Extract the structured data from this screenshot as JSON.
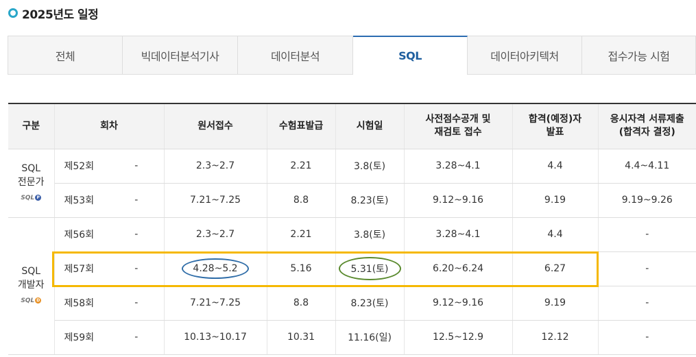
{
  "section_title": "2025년도 일정",
  "tabs": [
    {
      "label": "전체",
      "active": false
    },
    {
      "label": "빅데이터분석기사",
      "active": false
    },
    {
      "label": "데이터분석",
      "active": false
    },
    {
      "label": "SQL",
      "active": true
    },
    {
      "label": "데이터아키텍처",
      "active": false
    },
    {
      "label": "접수가능 시험",
      "active": false
    }
  ],
  "table": {
    "headers": [
      "구분",
      "회차",
      "원서접수",
      "수험표발급",
      "시험일",
      "사전점수공개 및\n재검토 접수",
      "합격(예정)자\n발표",
      "응시자격 서류제출\n(합격자 결정)"
    ],
    "groups": [
      {
        "name": "SQL\n전문가",
        "logo": "SQL",
        "logo_mark": "P",
        "logo_mark_color": "#3b5ea8",
        "rows": [
          {
            "round": "제52회",
            "sub": "-",
            "apply": "2.3~2.7",
            "ticket": "2.21",
            "exam": "3.8(토)",
            "review": "3.28~4.1",
            "announce": "4.4",
            "docs": "4.4~4.11"
          },
          {
            "round": "제53회",
            "sub": "-",
            "apply": "7.21~7.25",
            "ticket": "8.8",
            "exam": "8.23(토)",
            "review": "9.12~9.16",
            "announce": "9.19",
            "docs": "9.19~9.26"
          }
        ]
      },
      {
        "name": "SQL\n개발자",
        "logo": "SQL",
        "logo_mark": "D",
        "logo_mark_color": "#e8932a",
        "rows": [
          {
            "round": "제56회",
            "sub": "-",
            "apply": "2.3~2.7",
            "ticket": "2.21",
            "exam": "3.8(토)",
            "review": "3.28~4.1",
            "announce": "4.4",
            "docs": "-"
          },
          {
            "round": "제57회",
            "sub": "-",
            "apply": "4.28~5.2",
            "ticket": "5.16",
            "exam": "5.31(토)",
            "review": "6.20~6.24",
            "announce": "6.27",
            "docs": "-"
          },
          {
            "round": "제58회",
            "sub": "-",
            "apply": "7.21~7.25",
            "ticket": "8.8",
            "exam": "8.23(토)",
            "review": "9.12~9.16",
            "announce": "9.19",
            "docs": "-"
          },
          {
            "round": "제59회",
            "sub": "-",
            "apply": "10.13~10.17",
            "ticket": "10.31",
            "exam": "11.16(일)",
            "review": "12.5~12.9",
            "announce": "12.12",
            "docs": "-"
          }
        ]
      }
    ]
  },
  "annotations": {
    "highlight_color": "#f5b800",
    "circle_apply_color": "#2f6da8",
    "circle_exam_color": "#5a8a2e"
  }
}
